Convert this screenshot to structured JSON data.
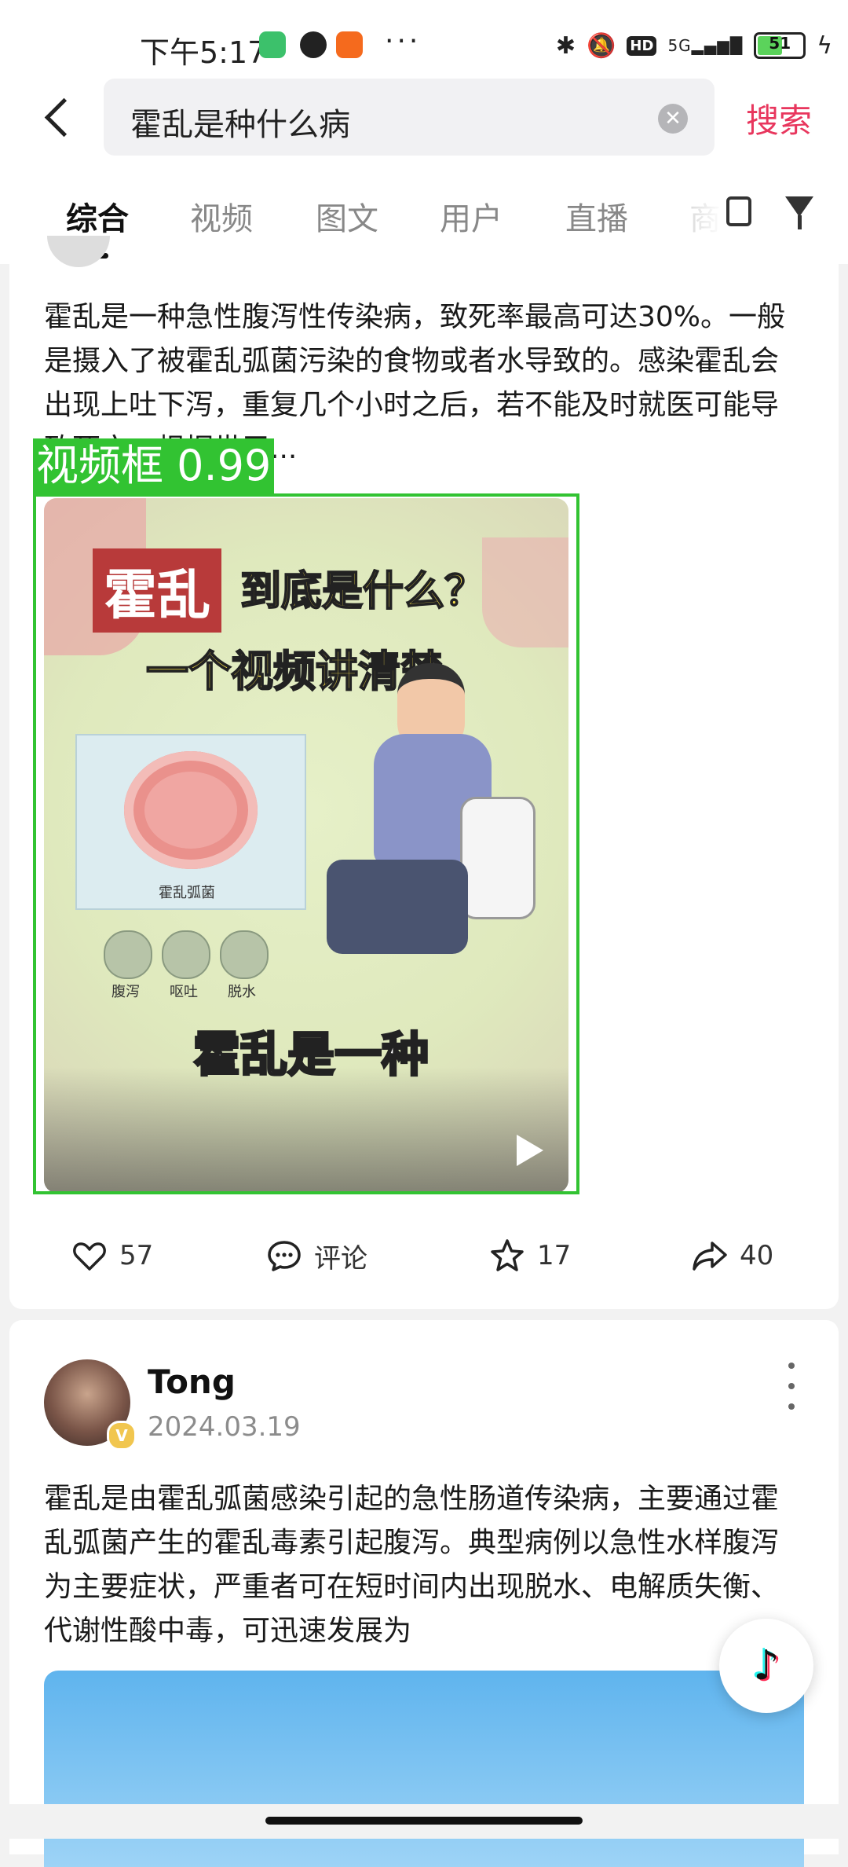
{
  "status_bar": {
    "time": "下午5:17",
    "app_icons": [
      "wechat-icon",
      "qq-icon",
      "58-icon"
    ],
    "more": "···",
    "network": "5G",
    "hd": "HD",
    "battery": "51",
    "battery_level": 0.51,
    "charging": true
  },
  "search": {
    "query": "霍乱是种什么病",
    "submit_label": "搜索"
  },
  "tabs": [
    {
      "label": "综合",
      "active": true
    },
    {
      "label": "视频"
    },
    {
      "label": "图文"
    },
    {
      "label": "用户"
    },
    {
      "label": "直播"
    },
    {
      "label": "商"
    }
  ],
  "posts": [
    {
      "text": "霍乱是一种急性腹泻性传染病，致死率最高可达30%。一般是摄入了被霍乱弧菌污染的食物或者水导致的。感染霍乱会出现上吐下泻，重复几个小时之后，若不能及时就医可能导致死亡。根据世卫...",
      "detection_label": "视频框 0.99",
      "video": {
        "title_red": "霍乱",
        "title_yellow": "到底是什么？",
        "subtitle": "一个视频讲清楚",
        "bacteria_label": "霍乱弧菌",
        "symptoms": [
          "腹泻",
          "呕吐",
          "脱水"
        ],
        "caption": "霍乱是一种"
      },
      "actions": {
        "likes": "57",
        "comments": "评论",
        "favorites": "17",
        "shares": "40"
      }
    },
    {
      "author": "Tong",
      "date": "2024.03.19",
      "verified_badge": "V",
      "text": "霍乱是由霍乱弧菌感染引起的急性肠道传染病，主要通过霍乱弧菌产生的霍乱毒素引起腹泻。典型病例以急性水样腹泻为主要症状，严重者可在短时间内出现脱水、电解质失衡、代谢性酸中毒，可迅速发展为"
    }
  ],
  "fab": {
    "label": "♪",
    "icon": "douyin-icon"
  },
  "colors": {
    "accent": "#e8365d",
    "detection": "#32c332"
  }
}
